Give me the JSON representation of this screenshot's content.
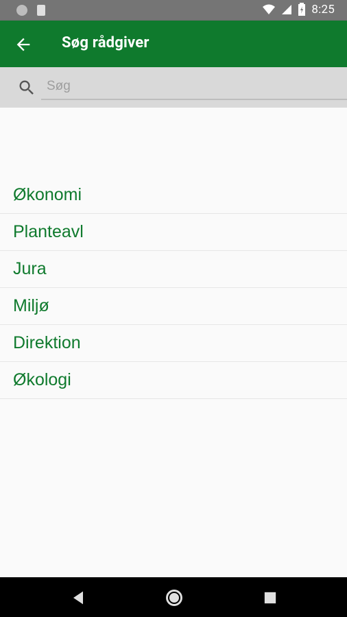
{
  "status_bar": {
    "time": "8:25"
  },
  "app_bar": {
    "title": "Søg rådgiver"
  },
  "search": {
    "placeholder": "Søg",
    "value": ""
  },
  "list": {
    "items": [
      {
        "label": "Økonomi"
      },
      {
        "label": "Planteavl"
      },
      {
        "label": "Jura"
      },
      {
        "label": "Miljø"
      },
      {
        "label": "Direktion"
      },
      {
        "label": "Økologi"
      }
    ]
  },
  "colors": {
    "primary_green": "#0f7a2d",
    "status_bar_gray": "#757575",
    "search_bar_gray": "#d9d9d9",
    "background": "#fafafa"
  }
}
